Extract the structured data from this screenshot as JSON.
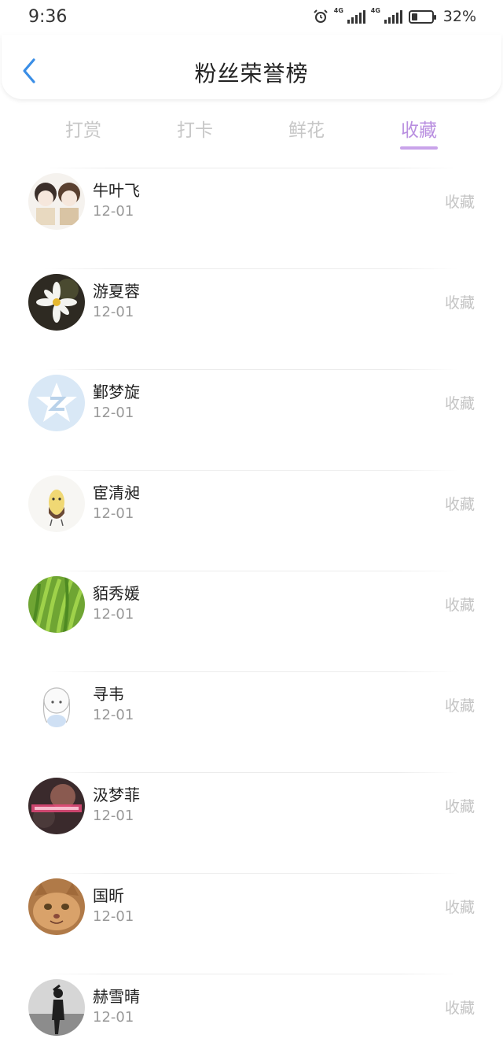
{
  "status_bar": {
    "time": "9:36",
    "network_1": "4G",
    "network_2": "4G",
    "battery_percent": "32%",
    "battery_level": 0.32
  },
  "header": {
    "title": "粉丝荣誉榜",
    "back_icon": "chevron-left-icon"
  },
  "tabs": [
    {
      "label": "打赏",
      "active": false
    },
    {
      "label": "打卡",
      "active": false
    },
    {
      "label": "鲜花",
      "active": false
    },
    {
      "label": "收藏",
      "active": true
    }
  ],
  "fans": [
    {
      "name": "牛叶飞",
      "date": "12-01",
      "action": "收藏"
    },
    {
      "name": "游夏蓉",
      "date": "12-01",
      "action": "收藏"
    },
    {
      "name": "鄞梦旋",
      "date": "12-01",
      "action": "收藏"
    },
    {
      "name": "宦清昶",
      "date": "12-01",
      "action": "收藏"
    },
    {
      "name": "貊秀媛",
      "date": "12-01",
      "action": "收藏"
    },
    {
      "name": "寻韦",
      "date": "12-01",
      "action": "收藏"
    },
    {
      "name": "汲梦菲",
      "date": "12-01",
      "action": "收藏"
    },
    {
      "name": "国昕",
      "date": "12-01",
      "action": "收藏"
    },
    {
      "name": "赫雪晴",
      "date": "12-01",
      "action": "收藏"
    }
  ],
  "colors": {
    "accent": "#b98fe0",
    "tab_inactive": "#c7c7c7",
    "back_icon": "#3a8ee6"
  }
}
